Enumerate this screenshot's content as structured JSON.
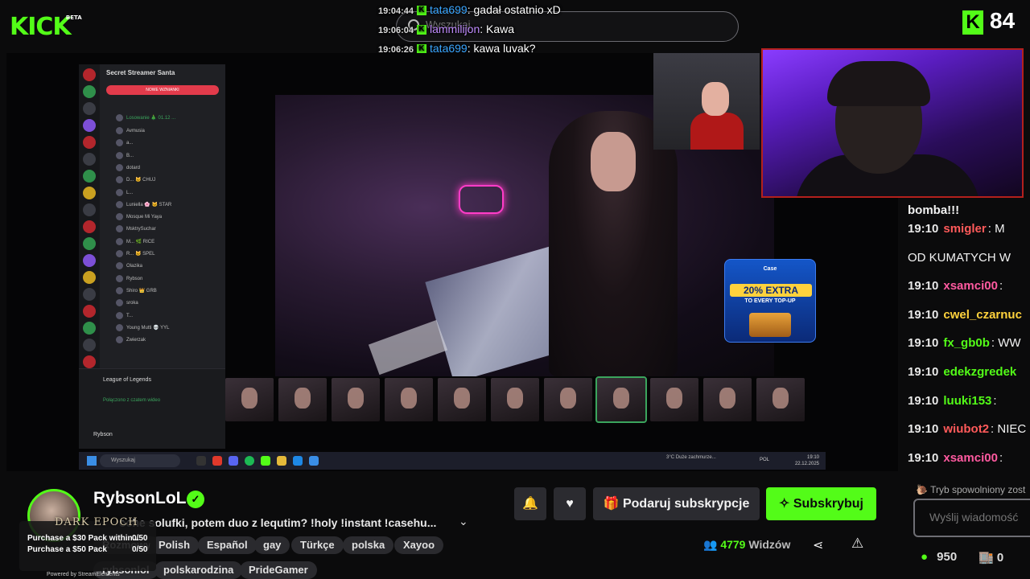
{
  "header": {
    "logo_text": "KICK",
    "logo_badge": "BETA",
    "search_placeholder": "Wyszukaj",
    "viewer_count": "84"
  },
  "overlay_chat": [
    {
      "time": "19:04:44",
      "user": "tata699",
      "message": ": gadał ostatnio xD",
      "user_color": "blue"
    },
    {
      "time": "19:06:04",
      "user": "lammilijon",
      "message": ": Kawa",
      "user_color": "purple"
    },
    {
      "time": "19:06:26",
      "user": "tata699",
      "message": ": kawa luvak?",
      "user_color": "blue"
    }
  ],
  "stream": {
    "discord": {
      "server_name": "Secret Streamer Santa",
      "primary_button": "NOWE WZNIANKI",
      "channel": "Losowanie 🎄 01.12 ...",
      "users": [
        "Avmusia",
        "a...",
        "B...",
        "dotard",
        "D... 🐱 CHUJ",
        "L...",
        "Luniella 🌸 🐱 STAR",
        "Mosque Mi Yaya",
        "MsktrySuchar",
        "M... 🌿 RICE",
        "R... 🐱 SPEL",
        "Olazika",
        "Rybson",
        "Shiro 👑 GRB",
        "sroka",
        "T...",
        "Young Mutti 💀 YYL",
        "Zwierzak"
      ],
      "game": "League of Legends",
      "voice_status": "Połączono z czatem wideo",
      "self_user": "Rybson"
    },
    "ad": {
      "brand": "Case",
      "headline": "20% EXTRA",
      "subline": "TO EVERY TOP-UP"
    },
    "taskbar": {
      "search": "Wyszukaj",
      "clock_time": "19:10",
      "clock_date": "22.12.2025",
      "weather": "3°C Duże zachmurze...",
      "lang": "POL"
    }
  },
  "chat": {
    "first_line": "bomba!!!",
    "rows": [
      {
        "time": "19:10",
        "user": "smigler",
        "message": ": M",
        "color": "#ff5a5a"
      },
      {
        "time": "",
        "user": "",
        "message": "OD KUMATYCH W",
        "color": ""
      },
      {
        "time": "19:10",
        "user": "xsamci00",
        "message": ":",
        "color": "#ff5aa0"
      },
      {
        "time": "19:10",
        "user": "cwel_czarnuc",
        "message": "",
        "color": "#ffd23c"
      },
      {
        "time": "19:10",
        "user": "fx_gb0b",
        "message": ": WW",
        "color": "#53fc18"
      },
      {
        "time": "19:10",
        "user": "edekzgredek",
        "message": "",
        "color": "#53fc18"
      },
      {
        "time": "19:10",
        "user": "luuki153",
        "message": ":",
        "color": "#53fc18"
      },
      {
        "time": "19:10",
        "user": "wiubot2",
        "message": ": NIEC",
        "color": "#ff5a5a"
      },
      {
        "time": "19:10",
        "user": "xsamci00",
        "message": ":",
        "color": "#ff5aa0"
      }
    ],
    "slow_mode": "Tryb spowolniony zost",
    "input_placeholder": "Wyślij wiadomość",
    "points": "950",
    "store_count": "0"
  },
  "channel": {
    "name": "RybsonLoL",
    "title": "oche solufki, potem duo z lequtim? !holy !instant !casehu...",
    "tags_row1": [
      "Rozmowy",
      "Polish",
      "Español",
      "gay",
      "Türkçe",
      "polska",
      "Xayoo"
    ],
    "tags_row2": [
      "rybsonlol",
      "polskarodzina",
      "PrideGamer"
    ],
    "gift_sub_label": "Podaruj subskrypcje",
    "subscribe_label": "Subskrybuj",
    "viewers": "4779",
    "viewers_label": "Widzów"
  },
  "widget": {
    "title": "DARK EPOCH",
    "quest1": "Purchase a $30 Pack within...",
    "quest1_count": "0/50",
    "quest2": "Purchase a $50 Pack",
    "quest2_count": "0/50",
    "footer": "Powered by StreamElements"
  },
  "colors": {
    "kick_green": "#53fc18",
    "background": "#0b0b0c",
    "button_grey": "#2b2b30"
  }
}
